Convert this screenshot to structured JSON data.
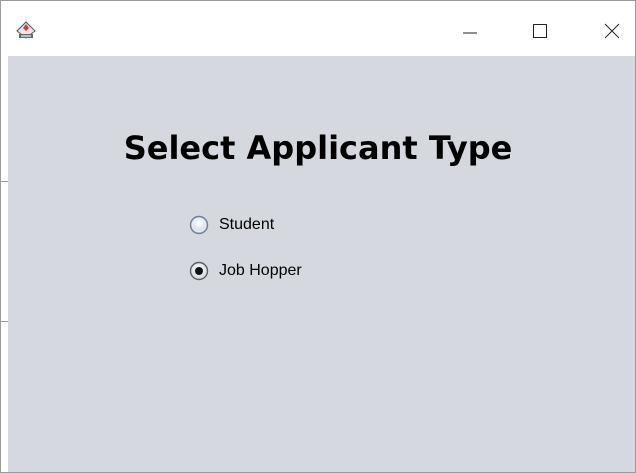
{
  "window": {
    "title": "",
    "app_icon": "java-app-icon",
    "controls": {
      "minimize_icon": "minimize-icon",
      "maximize_icon": "maximize-icon",
      "close_icon": "close-icon"
    }
  },
  "main": {
    "title": "Select Applicant Type",
    "options": [
      {
        "label": "Student",
        "selected": false
      },
      {
        "label": "Job Hopper",
        "selected": true
      }
    ]
  },
  "colors": {
    "content_background": "#d5d8df",
    "titlebar_background": "#ffffff",
    "text": "#000000"
  }
}
